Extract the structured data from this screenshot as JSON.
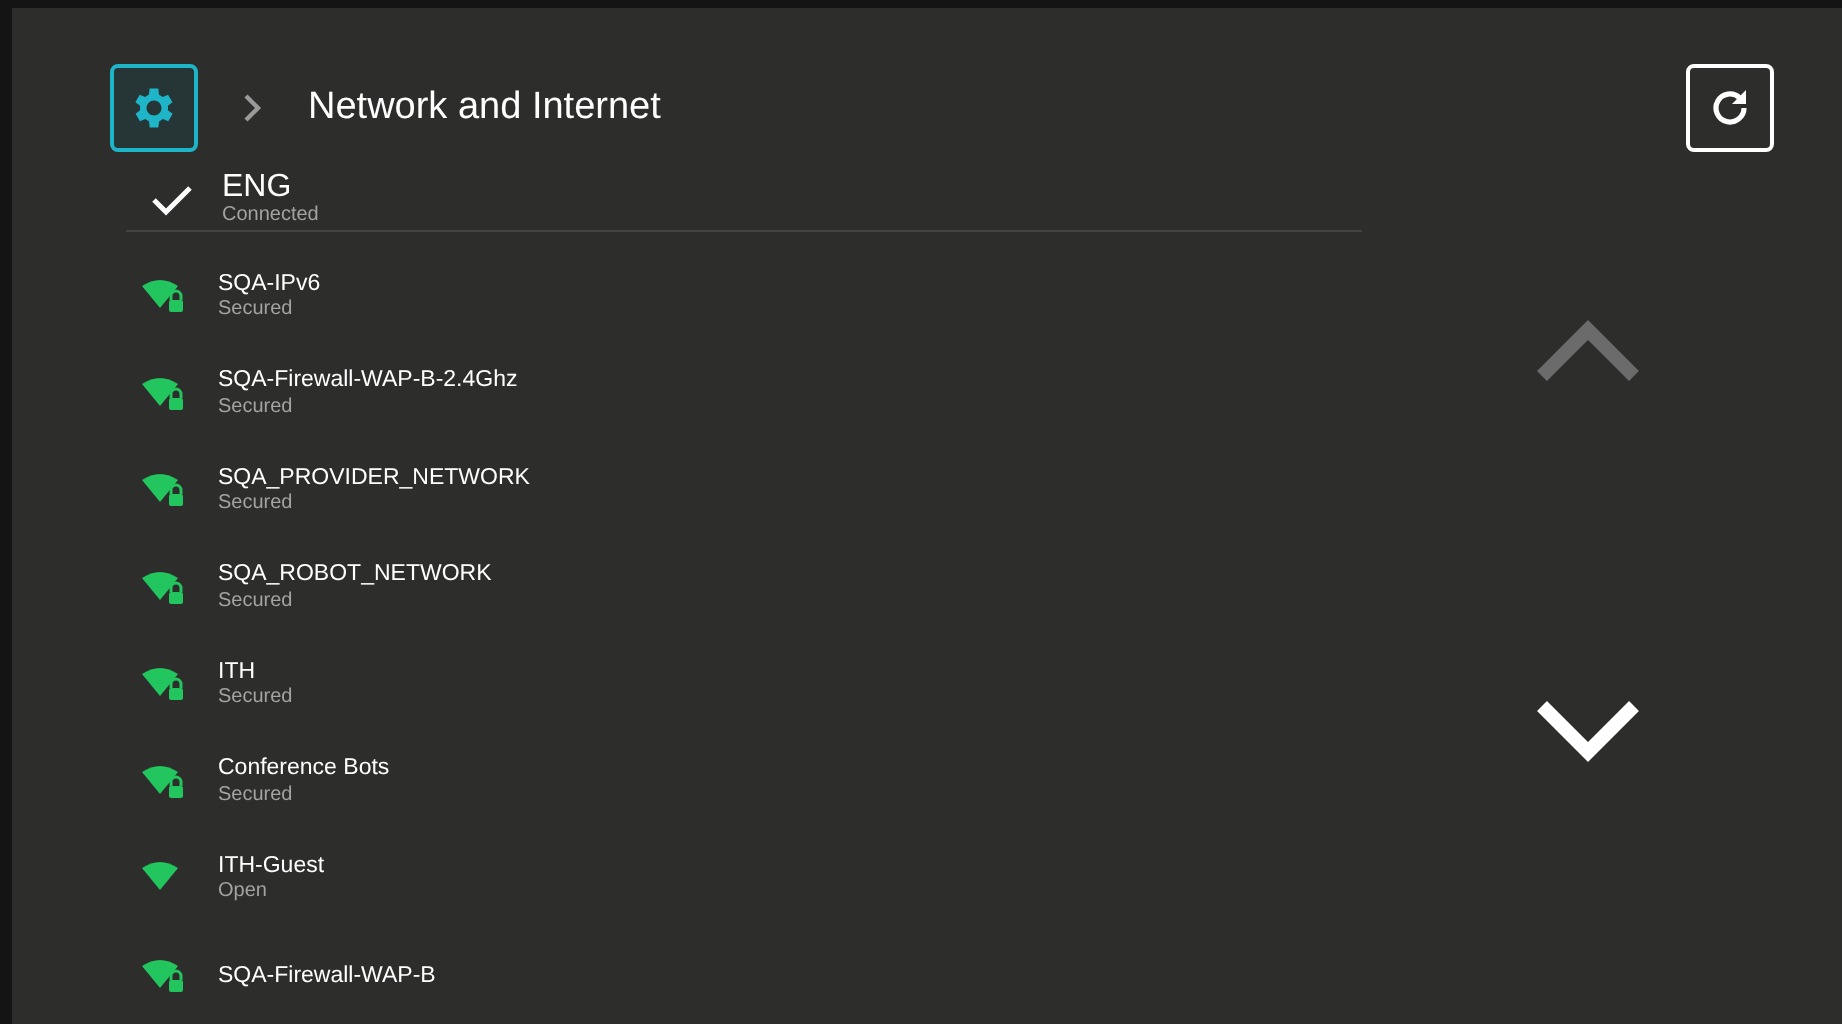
{
  "header": {
    "breadcrumb": "Network and Internet"
  },
  "connected": {
    "name": "ENG",
    "status": "Connected"
  },
  "networks": [
    {
      "name": "SQA-IPv6",
      "status": "Secured",
      "secured": true
    },
    {
      "name": "SQA-Firewall-WAP-B-2.4Ghz",
      "status": "Secured",
      "secured": true
    },
    {
      "name": "SQA_PROVIDER_NETWORK",
      "status": "Secured",
      "secured": true
    },
    {
      "name": "SQA_ROBOT_NETWORK",
      "status": "Secured",
      "secured": true
    },
    {
      "name": "ITH",
      "status": "Secured",
      "secured": true
    },
    {
      "name": "Conference Bots",
      "status": "Secured",
      "secured": true
    },
    {
      "name": "ITH-Guest",
      "status": "Open",
      "secured": false
    },
    {
      "name": "SQA-Firewall-WAP-B",
      "secured": true
    }
  ],
  "scroll": {
    "up_disabled": true,
    "down_disabled": false
  }
}
